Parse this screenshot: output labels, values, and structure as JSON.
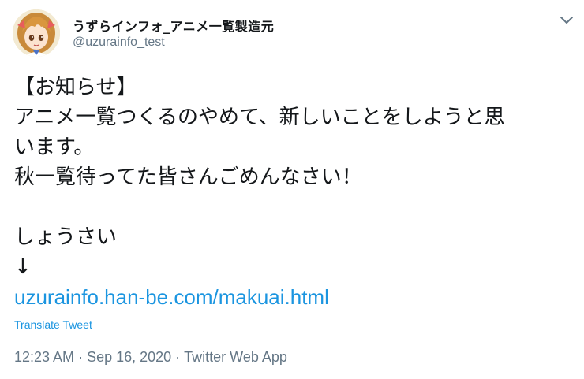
{
  "author": {
    "display_name": "うずらインフォ_アニメ一覧製造元",
    "handle": "@uzurainfo_test",
    "avatar_icon": "anime-character-avatar"
  },
  "menu": {
    "icon": "chevron-down-icon"
  },
  "tweet": {
    "lines": [
      "【お知らせ】",
      "アニメ一覧つくるのやめて、新しいことをしようと思",
      "います。",
      "秋一覧待ってた皆さんごめんなさい！",
      "",
      "しょうさい",
      "↓"
    ],
    "link": "uzurainfo.han-be.com/makuai.html"
  },
  "translate_label": "Translate Tweet",
  "meta": {
    "time": "12:23 AM",
    "separator": "·",
    "date": "Sep 16, 2020",
    "source": "Twitter Web App"
  },
  "colors": {
    "text": "#14171a",
    "secondary": "#657786",
    "link": "#1b95e0"
  }
}
